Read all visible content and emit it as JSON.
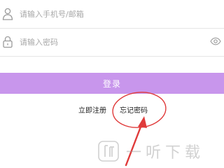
{
  "login_form": {
    "account_placeholder": "请输入手机号/邮箱",
    "password_placeholder": "请输入密码",
    "login_label": "登录",
    "accent_color": "#c896ec"
  },
  "links": {
    "register_label": "立即注册",
    "forgot_label": "忘记密码"
  },
  "annotation": {
    "circle_color": "#e03a3a",
    "arrow_color": "#e03a3a"
  },
  "watermark": {
    "text": "一听下载",
    "logo_icon": "app-logo-icon"
  },
  "icons": {
    "user": "user-icon",
    "lock": "lock-icon",
    "eye": "eye-icon"
  }
}
